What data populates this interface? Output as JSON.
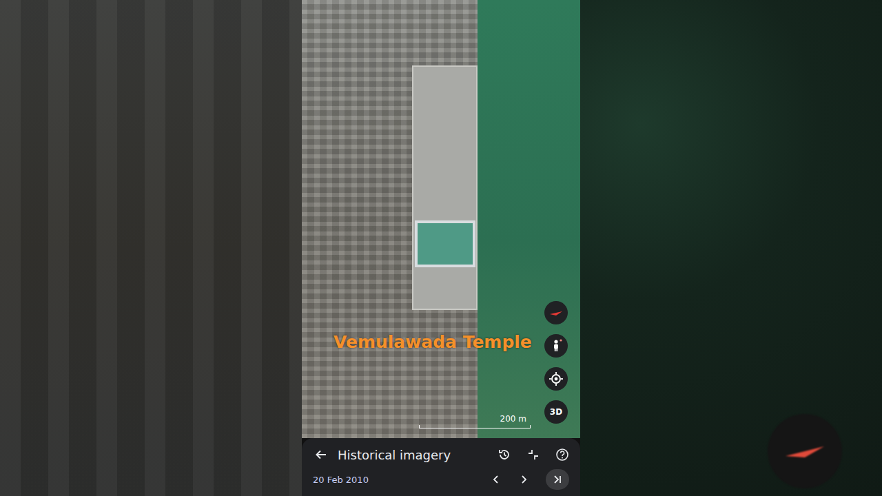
{
  "map": {
    "label": "Vemulawada Temple",
    "scale": "200 m",
    "controls": [
      {
        "kind": "compass"
      },
      {
        "kind": "pegman"
      },
      {
        "kind": "locate"
      },
      {
        "kind": "text",
        "label": "3D"
      }
    ]
  },
  "panel": {
    "title": "Historical imagery",
    "date": "20 Feb 2010"
  }
}
